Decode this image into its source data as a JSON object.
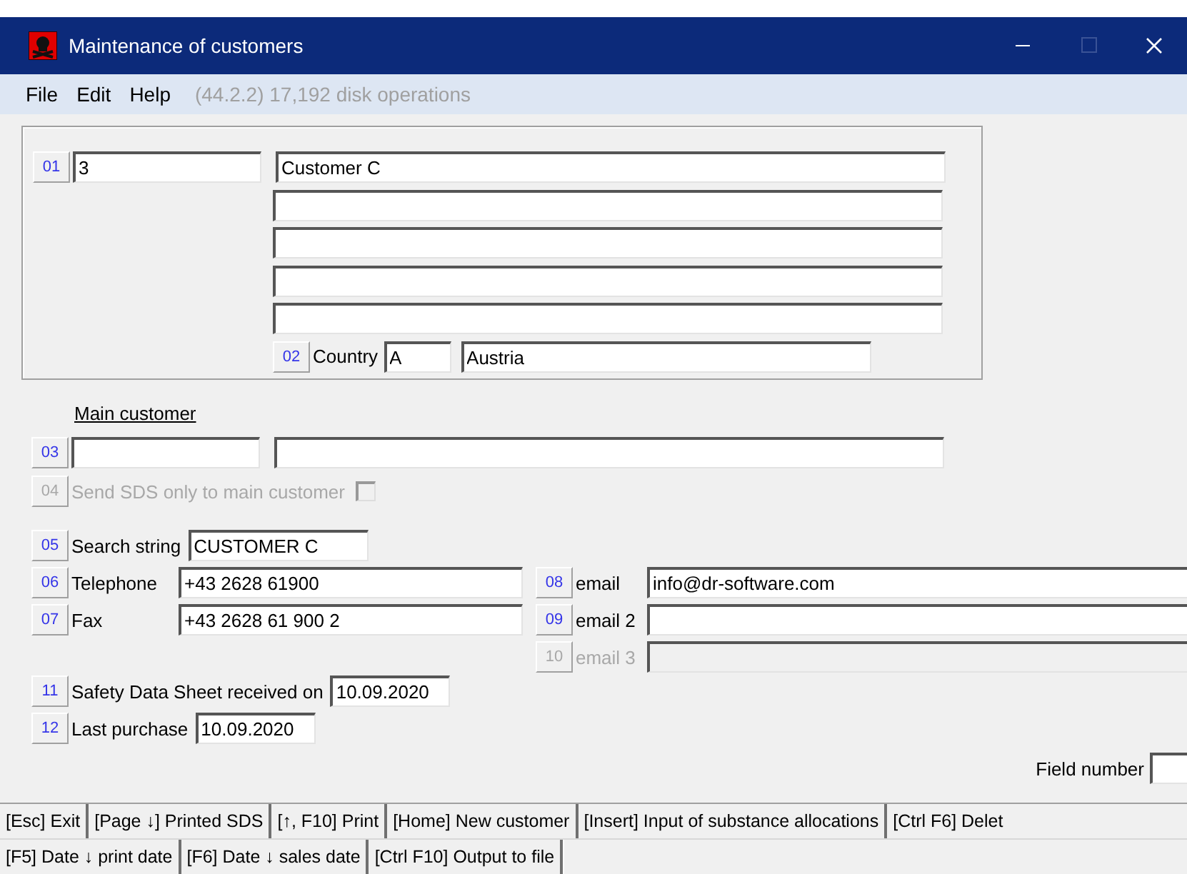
{
  "window": {
    "title": "Maintenance of customers"
  },
  "menu": {
    "items": [
      "File",
      "Edit",
      "Help"
    ],
    "info": "(44.2.2) 17,192 disk operations"
  },
  "customer": {
    "button": "01",
    "number": "3",
    "name": "Customer C"
  },
  "country": {
    "button": "02",
    "label": "Country",
    "code": "A",
    "name": "Austria"
  },
  "main_customer": {
    "heading": "Main customer",
    "button": "03"
  },
  "sds_only": {
    "button": "04",
    "label": "Send SDS only to main customer",
    "checked": false,
    "disabled": true
  },
  "search": {
    "button": "05",
    "label": "Search string",
    "value": "CUSTOMER C"
  },
  "phones": [
    {
      "button": "06",
      "label": "Telephone",
      "value": "+43 2628 61900"
    },
    {
      "button": "07",
      "label": "Fax",
      "value": "+43 2628 61 900 2"
    }
  ],
  "emails": [
    {
      "button": "08",
      "label": "email",
      "value": "info@dr-software.com",
      "disabled": false
    },
    {
      "button": "09",
      "label": "email 2",
      "disabled": false
    },
    {
      "button": "10",
      "label": "email 3",
      "disabled": true
    }
  ],
  "dates": [
    {
      "button": "11",
      "label": "Safety Data Sheet received on",
      "value": "10.09.2020"
    },
    {
      "button": "12",
      "label": "Last purchase",
      "value": "10.09.2020"
    }
  ],
  "field_number": {
    "label": "Field number"
  },
  "keys": [
    [
      "[Esc] Exit",
      "[Page ↓] Printed SDS",
      "[↑, F10] Print",
      "[Home] New customer",
      "[Insert] Input of substance allocations",
      "[Ctrl F6] Delet"
    ],
    [
      "[F5] Date ↓ print date",
      "[F6] Date ↓ sales date",
      "[Ctrl F10] Output to file"
    ]
  ]
}
